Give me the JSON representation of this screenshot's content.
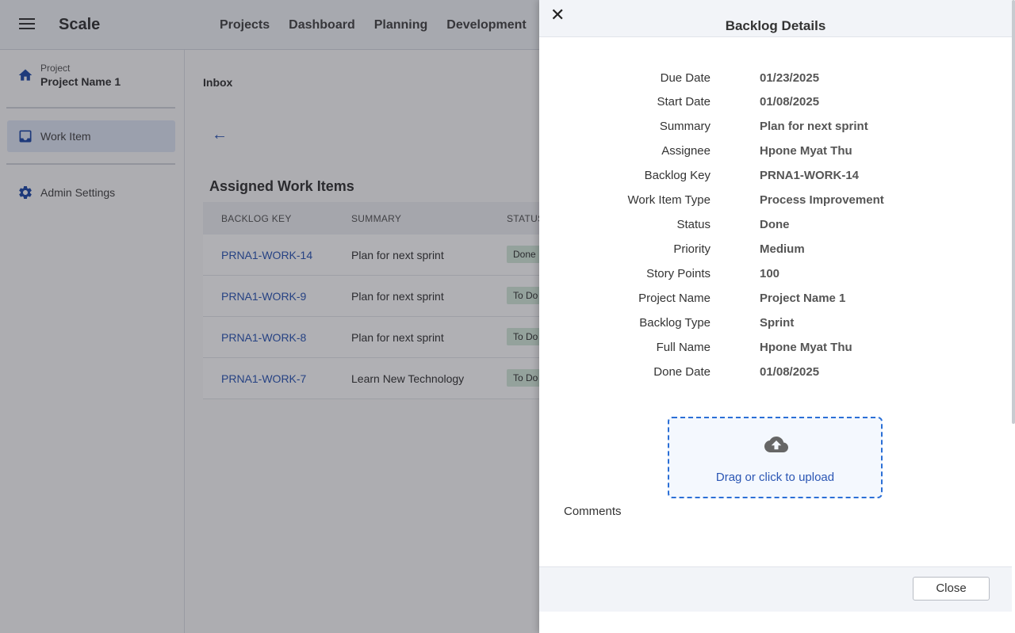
{
  "app": {
    "title": "Scale"
  },
  "topnav": [
    {
      "label": "Projects"
    },
    {
      "label": "Dashboard"
    },
    {
      "label": "Planning"
    },
    {
      "label": "Development"
    }
  ],
  "sidebar": {
    "project_small": "Project",
    "project_name": "Project Name 1",
    "items": [
      {
        "label": "Work Item",
        "icon": "inbox-icon",
        "active": true
      },
      {
        "label": "Admin Settings",
        "icon": "gear-icon",
        "active": false
      }
    ]
  },
  "main": {
    "breadcrumb": "Inbox",
    "back_icon": "←",
    "section_title": "Assigned Work Items",
    "columns": [
      "BACKLOG KEY",
      "SUMMARY",
      "STATUS"
    ],
    "rows": [
      {
        "key": "PRNA1-WORK-14",
        "summary": "Plan for next sprint",
        "status": "Done"
      },
      {
        "key": "PRNA1-WORK-9",
        "summary": "Plan for next sprint",
        "status": "To Do"
      },
      {
        "key": "PRNA1-WORK-8",
        "summary": "Plan for next sprint",
        "status": "To Do"
      },
      {
        "key": "PRNA1-WORK-7",
        "summary": "Learn New Technology",
        "status": "To Do"
      }
    ]
  },
  "drawer": {
    "close_icon": "✕",
    "title": "Backlog Details",
    "details": [
      {
        "label": "Due Date",
        "value": "01/23/2025"
      },
      {
        "label": "Start Date",
        "value": "01/08/2025"
      },
      {
        "label": "Summary",
        "value": "Plan for next sprint"
      },
      {
        "label": "Assignee",
        "value": "Hpone Myat Thu"
      },
      {
        "label": "Backlog Key",
        "value": "PRNA1-WORK-14"
      },
      {
        "label": "Work Item Type",
        "value": "Process Improvement"
      },
      {
        "label": "Status",
        "value": "Done"
      },
      {
        "label": "Priority",
        "value": "Medium"
      },
      {
        "label": "Story Points",
        "value": "100"
      },
      {
        "label": "Project Name",
        "value": "Project Name 1"
      },
      {
        "label": "Backlog Type",
        "value": "Sprint"
      },
      {
        "label": "Full Name",
        "value": "Hpone Myat Thu"
      },
      {
        "label": "Done Date",
        "value": "01/08/2025"
      }
    ],
    "upload_label": "Drag or click to upload",
    "comments_label": "Comments",
    "close_button": "Close"
  },
  "colors": {
    "accent": "#2b56b4",
    "status_done_bg": "#d4eadb"
  }
}
